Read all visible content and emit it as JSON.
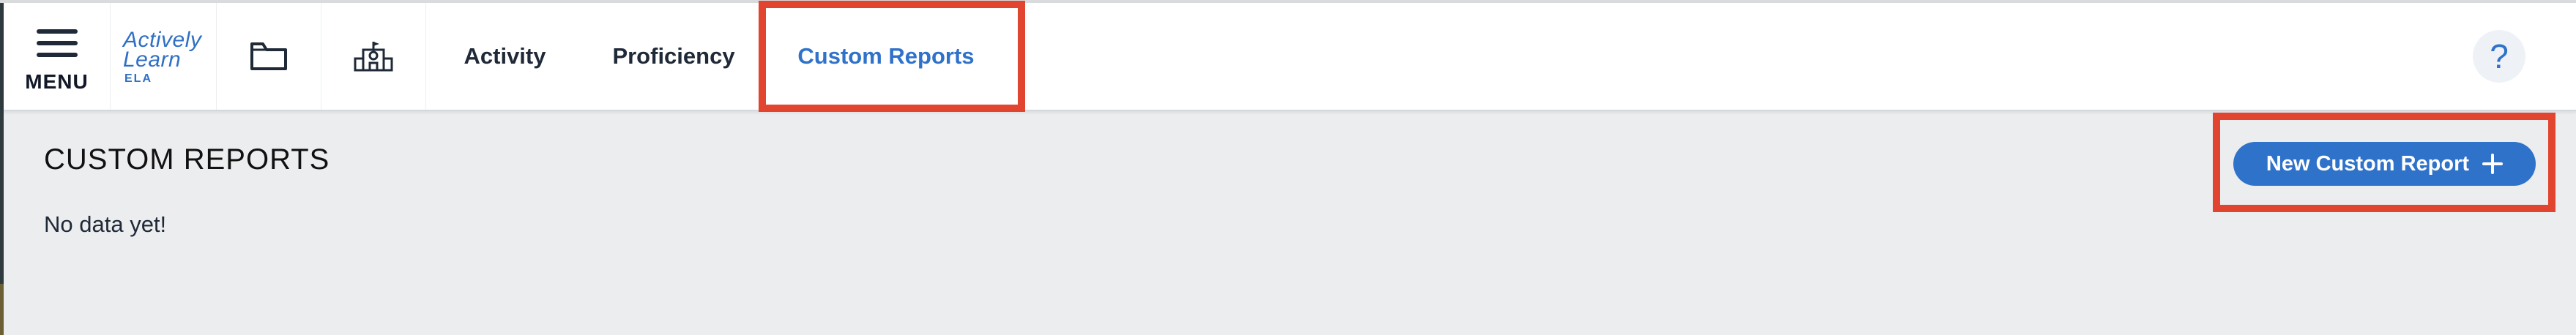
{
  "header": {
    "menu_label": "MENU",
    "logo": {
      "line1": "Actively",
      "line2": "Learn",
      "sub": "ELA"
    },
    "tabs": [
      {
        "label": "Activity"
      },
      {
        "label": "Proficiency"
      },
      {
        "label": "Custom Reports",
        "active": true
      }
    ],
    "help_label": "?"
  },
  "main": {
    "title": "CUSTOM REPORTS",
    "empty_message": "No data yet!",
    "new_report_label": "New Custom Report"
  },
  "colors": {
    "accent": "#2f72c9",
    "highlight": "#e2452f",
    "background": "#ecedef"
  },
  "icons": [
    "menu-icon",
    "folder-icon",
    "school-icon",
    "help-icon",
    "plus-icon"
  ]
}
